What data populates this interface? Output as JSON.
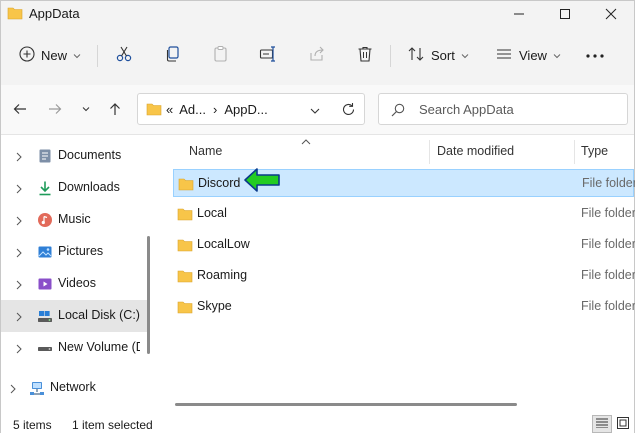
{
  "window": {
    "title": "AppData",
    "controls": [
      "minimize",
      "maximize",
      "close"
    ]
  },
  "toolbar": {
    "new_label": "New",
    "sort_label": "Sort",
    "view_label": "View",
    "more_label": "...",
    "icons": [
      "cut-icon",
      "copy-icon",
      "paste-icon",
      "rename-icon",
      "share-icon",
      "delete-icon"
    ]
  },
  "address": {
    "overflow": "«",
    "crumbs": [
      "Ad...",
      "AppD..."
    ],
    "separator": "›"
  },
  "search": {
    "placeholder": "Search AppData"
  },
  "nav": {
    "items": [
      {
        "label": "Documents",
        "icon": "documents-icon"
      },
      {
        "label": "Downloads",
        "icon": "downloads-icon"
      },
      {
        "label": "Music",
        "icon": "music-icon"
      },
      {
        "label": "Pictures",
        "icon": "pictures-icon"
      },
      {
        "label": "Videos",
        "icon": "videos-icon"
      },
      {
        "label": "Local Disk (C:)",
        "icon": "drive-icon",
        "selected": true
      },
      {
        "label": "New Volume (D:)",
        "icon": "drive-icon"
      },
      {
        "label": "Network",
        "icon": "network-icon"
      }
    ]
  },
  "columns": {
    "name": "Name",
    "date_modified": "Date modified",
    "type": "Type"
  },
  "files": [
    {
      "name": "Discord",
      "type": "File folder",
      "selected": true
    },
    {
      "name": "Local",
      "type": "File folder"
    },
    {
      "name": "LocalLow",
      "type": "File folder"
    },
    {
      "name": "Roaming",
      "type": "File folder"
    },
    {
      "name": "Skype",
      "type": "File folder"
    }
  ],
  "status": {
    "items_count": "5 items",
    "selection": "1 item selected"
  },
  "colors": {
    "selection_bg": "#cce8ff",
    "selection_border": "#99d1ff",
    "folder": "#f8c549",
    "annotation_arrow": "#22cc22"
  }
}
